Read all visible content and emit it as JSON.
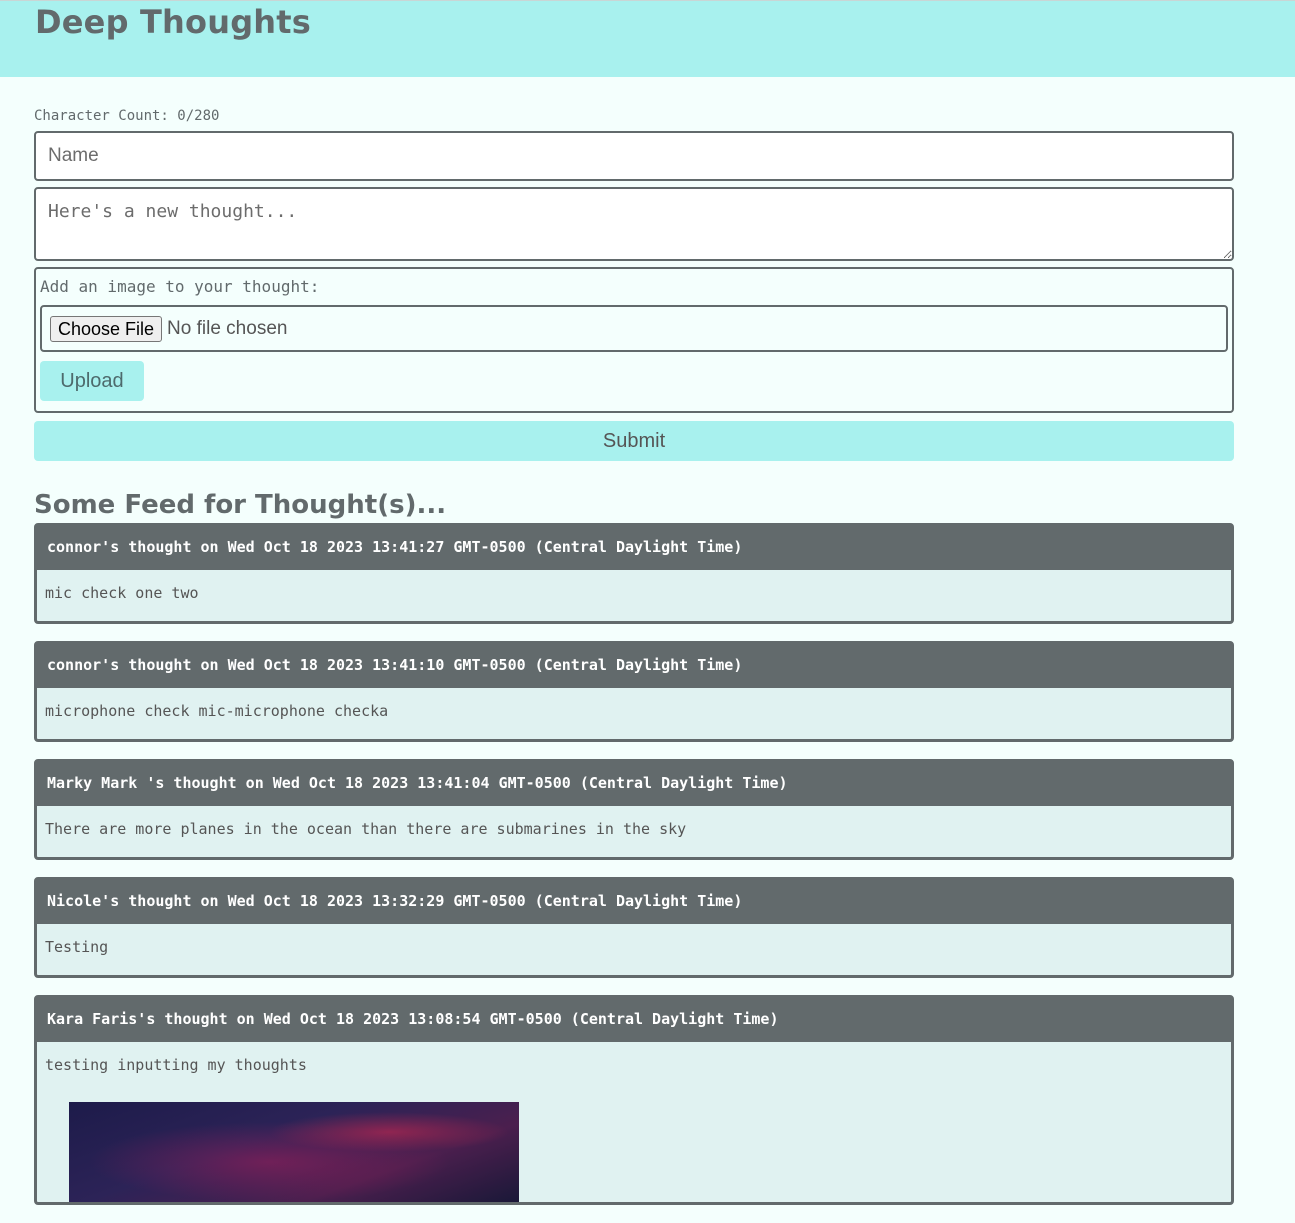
{
  "header": {
    "title": "Deep Thoughts"
  },
  "form": {
    "char_count": "Character Count: 0/280",
    "name_placeholder": "Name",
    "thought_placeholder": "Here's a new thought...",
    "image_label": "Add an image to your thought:",
    "choose_file_label": "Choose File",
    "no_file_label": "No file chosen",
    "upload_label": "Upload",
    "submit_label": "Submit"
  },
  "feed": {
    "title": "Some Feed for Thought(s)...",
    "thoughts": [
      {
        "header": "connor's thought on Wed Oct 18 2023 13:41:27 GMT-0500 (Central Daylight Time)",
        "body": "mic check one two"
      },
      {
        "header": "connor's thought on Wed Oct 18 2023 13:41:10 GMT-0500 (Central Daylight Time)",
        "body": "microphone check mic-microphone checka"
      },
      {
        "header": "Marky Mark 's thought on Wed Oct 18 2023 13:41:04 GMT-0500 (Central Daylight Time)",
        "body": "There are more planes in the ocean than there are submarines in the sky"
      },
      {
        "header": "Nicole's thought on Wed Oct 18 2023 13:32:29 GMT-0500 (Central Daylight Time)",
        "body": "Testing"
      },
      {
        "header": "Kara Faris's thought on Wed Oct 18 2023 13:08:54 GMT-0500 (Central Daylight Time)",
        "body": "testing inputting my thoughts"
      }
    ]
  },
  "colors": {
    "accent": "#a8f1ee",
    "dark": "#626a6c",
    "card_bg": "#e0f2f1",
    "page_bg": "#f4fffd"
  }
}
